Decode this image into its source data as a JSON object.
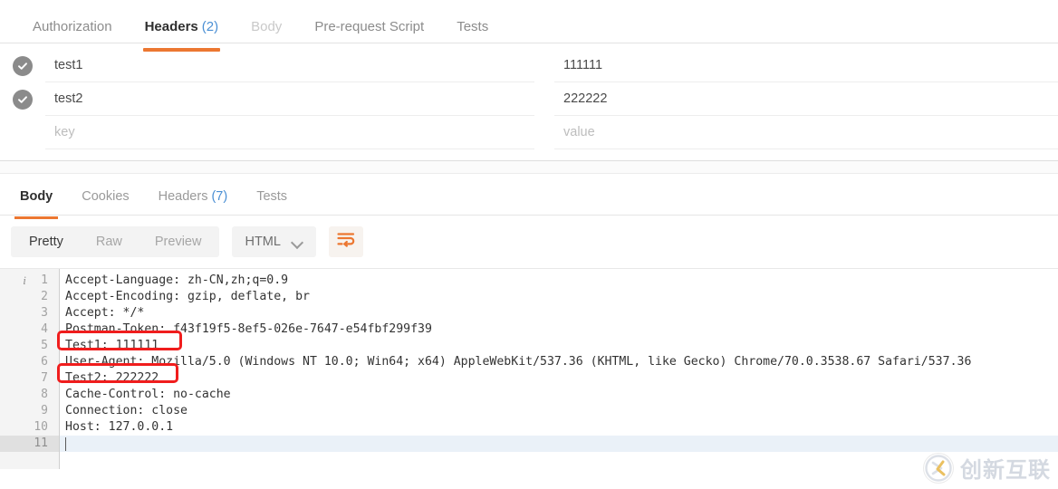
{
  "request_tabs": [
    {
      "label": "Authorization",
      "count": "",
      "state": "normal"
    },
    {
      "label": "Headers",
      "count": "(2)",
      "state": "active"
    },
    {
      "label": "Body",
      "count": "",
      "state": "dim"
    },
    {
      "label": "Pre-request Script",
      "count": "",
      "state": "normal"
    },
    {
      "label": "Tests",
      "count": "",
      "state": "normal"
    }
  ],
  "headers_table": {
    "rows": [
      {
        "checked": true,
        "key": "test1",
        "value": "111111"
      },
      {
        "checked": true,
        "key": "test2",
        "value": "222222"
      }
    ],
    "placeholder_key": "key",
    "placeholder_value": "value"
  },
  "response_tabs": [
    {
      "label": "Body",
      "count": "",
      "state": "active"
    },
    {
      "label": "Cookies",
      "count": "",
      "state": "normal"
    },
    {
      "label": "Headers",
      "count": "(7)",
      "state": "normal"
    },
    {
      "label": "Tests",
      "count": "",
      "state": "normal"
    }
  ],
  "toolbar": {
    "view_modes": [
      {
        "label": "Pretty",
        "active": true
      },
      {
        "label": "Raw",
        "active": false
      },
      {
        "label": "Preview",
        "active": false
      }
    ],
    "format_selected": "HTML",
    "wrap_icon": "word-wrap-icon"
  },
  "code": {
    "lines": [
      {
        "num": "1",
        "text": "Accept-Language: zh-CN,zh;q=0.9"
      },
      {
        "num": "2",
        "text": "Accept-Encoding: gzip, deflate, br"
      },
      {
        "num": "3",
        "text": "Accept: */*"
      },
      {
        "num": "4",
        "text": "Postman-Token: f43f19f5-8ef5-026e-7647-e54fbf299f39"
      },
      {
        "num": "5",
        "text": "Test1: 111111"
      },
      {
        "num": "6",
        "text": "User-Agent: Mozilla/5.0 (Windows NT 10.0; Win64; x64) AppleWebKit/537.36 (KHTML, like Gecko) Chrome/70.0.3538.67 Safari/537.36"
      },
      {
        "num": "7",
        "text": "Test2: 222222"
      },
      {
        "num": "8",
        "text": "Cache-Control: no-cache"
      },
      {
        "num": "9",
        "text": "Connection: close"
      },
      {
        "num": "10",
        "text": "Host: 127.0.0.1"
      },
      {
        "num": "11",
        "text": ""
      }
    ],
    "active_line": "11",
    "info_icon": "info-icon"
  },
  "annotations": {
    "highlight_color": "#f01d1d",
    "boxes": [
      {
        "target_line": "5",
        "label": "Test1: 111111"
      },
      {
        "target_line": "7",
        "label": "Test2: 222222"
      }
    ]
  },
  "watermark": {
    "text": "创新互联"
  },
  "colors": {
    "accent": "#ec7731",
    "count_blue": "#4a8fd4",
    "checkbox_gray": "#8b8b8b",
    "active_line_bg": "#eaf1f8"
  }
}
